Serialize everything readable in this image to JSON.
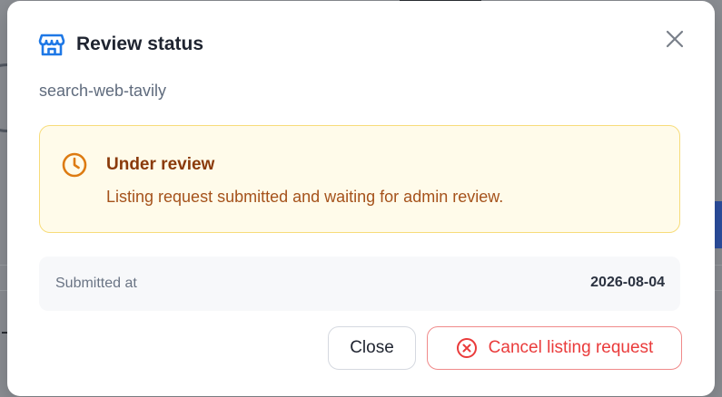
{
  "modal": {
    "title": "Review status",
    "subtitle": "search-web-tavily",
    "icons": {
      "title_icon": "store-icon",
      "close_icon": "close-icon",
      "status_icon": "clock-icon",
      "cancel_icon": "x-circle-icon"
    }
  },
  "status_alert": {
    "title": "Under review",
    "message": "Listing request submitted and waiting for admin review."
  },
  "info": {
    "label": "Submitted at",
    "value": "2026-08-04"
  },
  "actions": {
    "close_label": "Close",
    "cancel_label": "Cancel listing request"
  },
  "colors": {
    "accent_blue": "#1e78e6",
    "warning_bg": "#fffbea",
    "warning_border": "#f7dc7a",
    "warning_icon": "#dd7b12",
    "warning_title": "#8a3a0a",
    "danger": "#ea3b3b"
  }
}
